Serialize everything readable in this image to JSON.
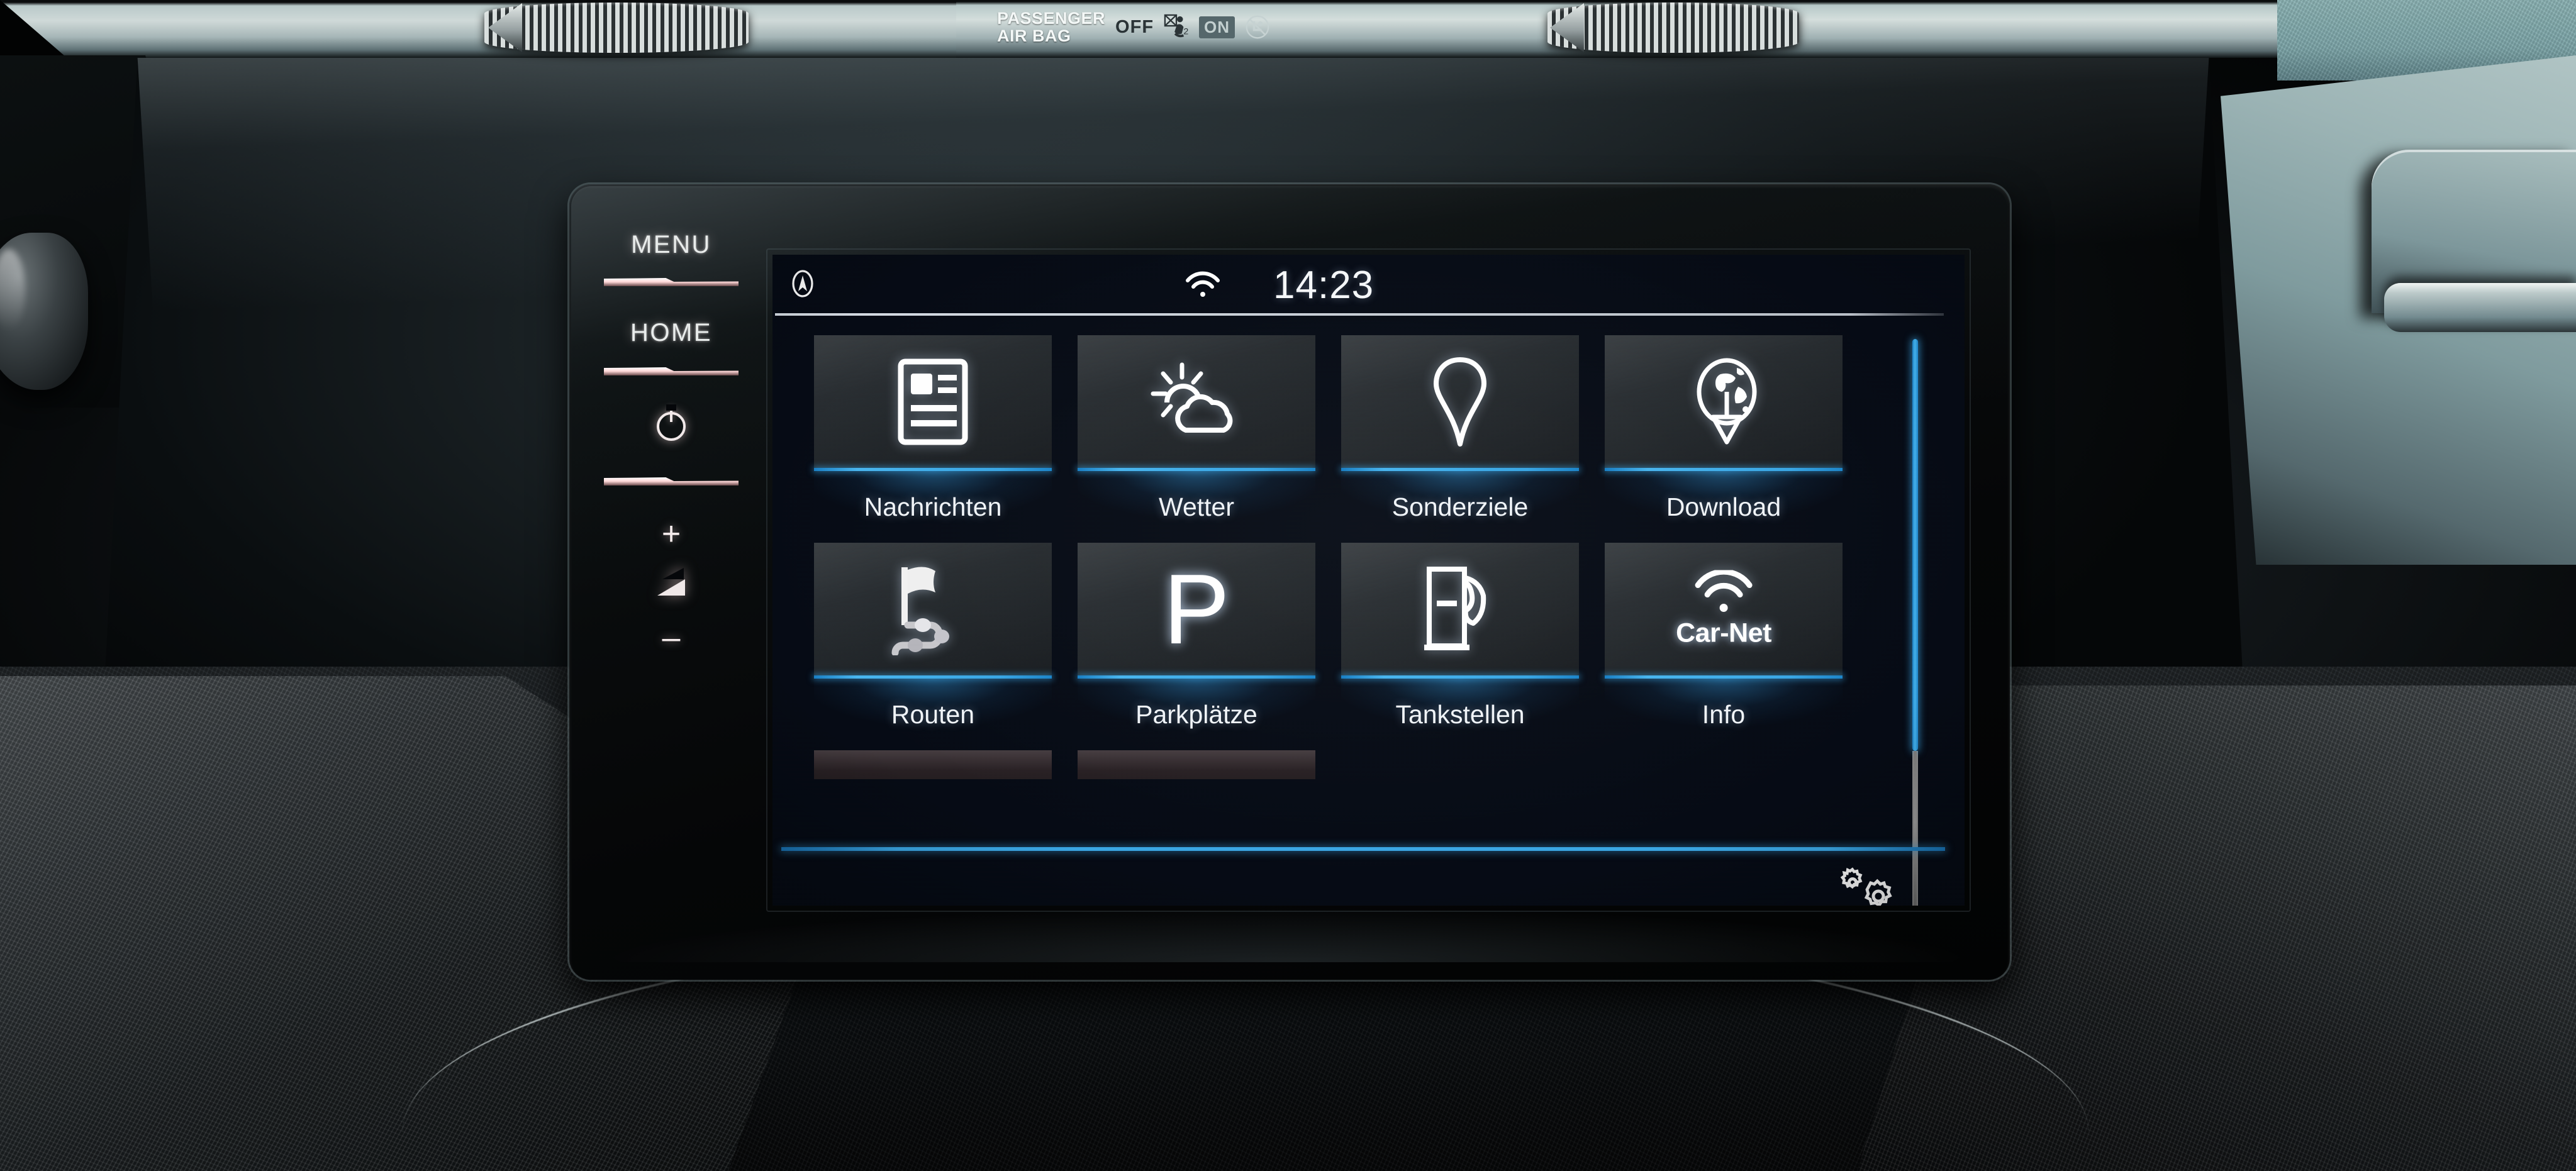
{
  "dashboard": {
    "airbag": {
      "label_line1": "PASSENGER",
      "label_line2": "AIR BAG",
      "off_label": "OFF",
      "on_label": "ON",
      "off_icon": "child-seat-crossed-icon",
      "on_icon": "child-seat-prohibited-icon"
    },
    "vent_left_icon": "air-vent-icon",
    "vent_right_icon": "air-vent-icon",
    "trim_color": "#8bb3b4",
    "console_color": "#1a2124"
  },
  "headunit": {
    "hardkeys": [
      {
        "label": "MENU",
        "name": "menu-key"
      },
      {
        "label": "HOME",
        "name": "home-key"
      },
      {
        "label": "",
        "name": "power-key",
        "icon": "power-icon"
      },
      {
        "label": "+",
        "name": "volume-up-key",
        "icon": "plus-icon"
      },
      {
        "label": "",
        "name": "volume-key",
        "icon": "volume-triangle-icon"
      },
      {
        "label": "–",
        "name": "volume-down-key",
        "icon": "minus-icon"
      }
    ]
  },
  "statusbar": {
    "nav_icon": "compass-navigation-icon",
    "wifi_icon": "wifi-icon",
    "clock": "14:23"
  },
  "apps": {
    "accent_color": "#3aa6e4",
    "row1": [
      {
        "label": "Nachrichten",
        "icon": "news-article-icon",
        "name": "app-tile-nachrichten"
      },
      {
        "label": "Wetter",
        "icon": "sun-cloud-weather-icon",
        "name": "app-tile-wetter"
      },
      {
        "label": "Sonderziele",
        "icon": "map-pin-icon",
        "name": "app-tile-sonderziele"
      },
      {
        "label": "Download",
        "icon": "globe-download-icon",
        "name": "app-tile-download"
      }
    ],
    "row2": [
      {
        "label": "Routen",
        "icon": "flag-route-icon",
        "name": "app-tile-routen"
      },
      {
        "label": "Parkplätze",
        "icon": "parking-p-glyph",
        "glyph": "P",
        "name": "app-tile-parkplaetze"
      },
      {
        "label": "Tankstellen",
        "icon": "fuel-pump-icon",
        "name": "app-tile-tankstellen"
      },
      {
        "label": "Info",
        "icon": "car-net-wifi-icon",
        "glyph": "Car-Net",
        "name": "app-tile-info"
      }
    ],
    "row3_partial": [
      {
        "label": "",
        "name": "app-tile-partial-1"
      },
      {
        "label": "",
        "name": "app-tile-partial-2"
      }
    ]
  },
  "bottombar": {
    "settings_icon": "gears-settings-icon"
  },
  "scrollbar": {
    "thumb_percent": "72",
    "thumb_color": "#3aa6e4",
    "track_color": "#8b8b8b"
  }
}
